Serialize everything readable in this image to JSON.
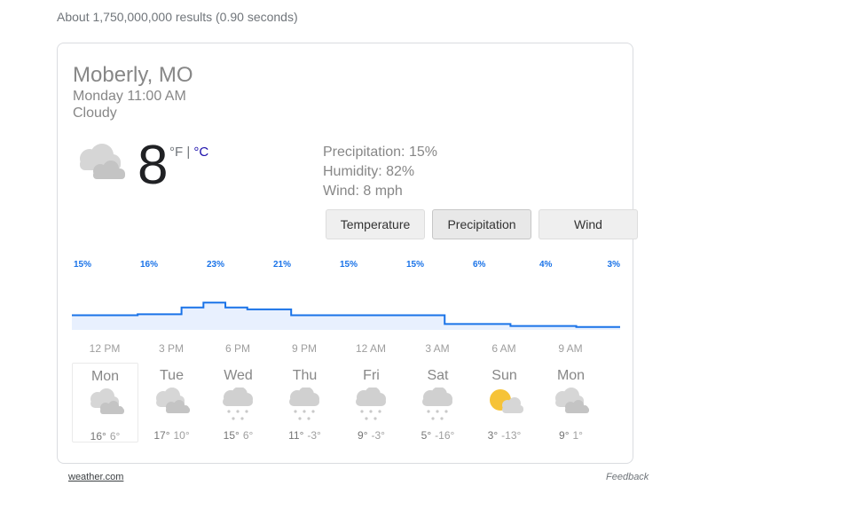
{
  "result_stats": "About 1,750,000,000 results (0.90 seconds)",
  "location": "Moberly, MO",
  "time": "Monday 11:00 AM",
  "condition": "Cloudy",
  "current_icon": "cloudy-icon",
  "temperature": "8",
  "unit_f": "°F",
  "unit_sep": " | ",
  "unit_c": "°C",
  "details": {
    "precipitation": "Precipitation: 15%",
    "humidity": "Humidity: 82%",
    "wind": "Wind: 8 mph"
  },
  "tabs": [
    {
      "label": "Temperature",
      "selected": false
    },
    {
      "label": "Precipitation",
      "selected": true
    },
    {
      "label": "Wind",
      "selected": false
    }
  ],
  "chart_data": {
    "type": "area",
    "series": [
      {
        "values": [
          15,
          16,
          23,
          21,
          15,
          15,
          6,
          4,
          3
        ]
      }
    ],
    "data_labels": [
      "15%",
      "16%",
      "23%",
      "21%",
      "15%",
      "15%",
      "6%",
      "4%",
      "3%"
    ],
    "x_tick_labels": [
      "12 PM",
      "3 PM",
      "6 PM",
      "9 PM",
      "12 AM",
      "3 AM",
      "6 AM",
      "9 AM"
    ],
    "hourly_values": [
      15,
      15,
      15,
      16,
      16,
      23,
      28,
      23,
      21,
      21,
      15,
      15,
      15,
      15,
      15,
      15,
      15,
      6,
      6,
      6,
      4,
      4,
      4,
      3,
      3
    ],
    "ylim": [
      0,
      100
    ],
    "colors": {
      "line": "#1a73e8",
      "fill": "#e8f0fe",
      "label": "#1a73e8",
      "tick": "#9e9e9e"
    }
  },
  "days": [
    {
      "name": "Mon",
      "icon": "cloudy-icon",
      "hi": "16°",
      "lo": "6°",
      "selected": true
    },
    {
      "name": "Tue",
      "icon": "cloudy-icon",
      "hi": "17°",
      "lo": "10°"
    },
    {
      "name": "Wed",
      "icon": "snow-icon",
      "hi": "15°",
      "lo": "6°"
    },
    {
      "name": "Thu",
      "icon": "snow-icon",
      "hi": "11°",
      "lo": "-3°"
    },
    {
      "name": "Fri",
      "icon": "snow-icon",
      "hi": "9°",
      "lo": "-3°"
    },
    {
      "name": "Sat",
      "icon": "snow-icon",
      "hi": "5°",
      "lo": "-16°"
    },
    {
      "name": "Sun",
      "icon": "partly-cloudy-icon",
      "hi": "3°",
      "lo": "-13°"
    },
    {
      "name": "Mon",
      "icon": "cloudy-icon",
      "hi": "9°",
      "lo": "1°"
    }
  ],
  "source": "weather.com",
  "feedback": "Feedback"
}
